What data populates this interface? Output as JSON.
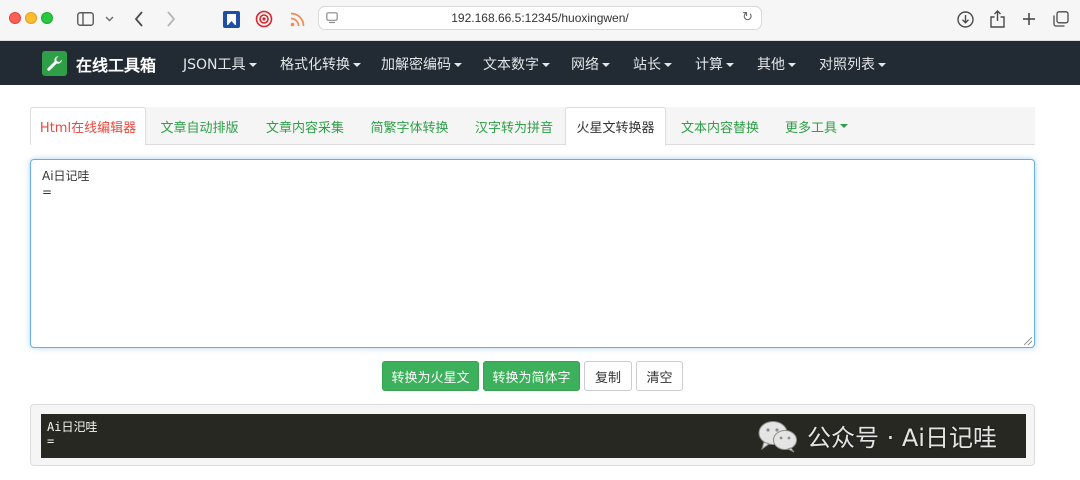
{
  "browser": {
    "url": "192.168.66.5:12345/huoxingwen/"
  },
  "navbar": {
    "brand": "在线工具箱",
    "items": [
      {
        "label": "JSON工具"
      },
      {
        "label": "格式化转换"
      },
      {
        "label": "加解密编码"
      },
      {
        "label": "文本数字"
      },
      {
        "label": "网络"
      },
      {
        "label": "站长"
      },
      {
        "label": "计算"
      },
      {
        "label": "其他"
      },
      {
        "label": "对照列表"
      }
    ]
  },
  "tabs": [
    {
      "label": "Html在线编辑器"
    },
    {
      "label": "文章自动排版"
    },
    {
      "label": "文章内容采集"
    },
    {
      "label": "简繁字体转换"
    },
    {
      "label": "汉字转为拼音"
    },
    {
      "label": "火星文转换器"
    },
    {
      "label": "文本内容替换"
    },
    {
      "label": "更多工具"
    }
  ],
  "input": {
    "line1": "Ai日记哇",
    "line2": "="
  },
  "buttons": {
    "to_martian": "转换为火星文",
    "to_simplified": "转换为简体字",
    "copy": "复制",
    "clear": "清空"
  },
  "output": {
    "line1": "Ai日汜哇",
    "line2": "="
  },
  "watermark": {
    "text": "公众号 · Ai日记哇"
  },
  "colors": {
    "navbar_bg": "#222b33",
    "brand_green": "#2e9f47",
    "tab_text": "#2e9f47",
    "first_tab_text": "#e9483f",
    "button_green": "#3cb05a",
    "output_bg": "#272822"
  }
}
